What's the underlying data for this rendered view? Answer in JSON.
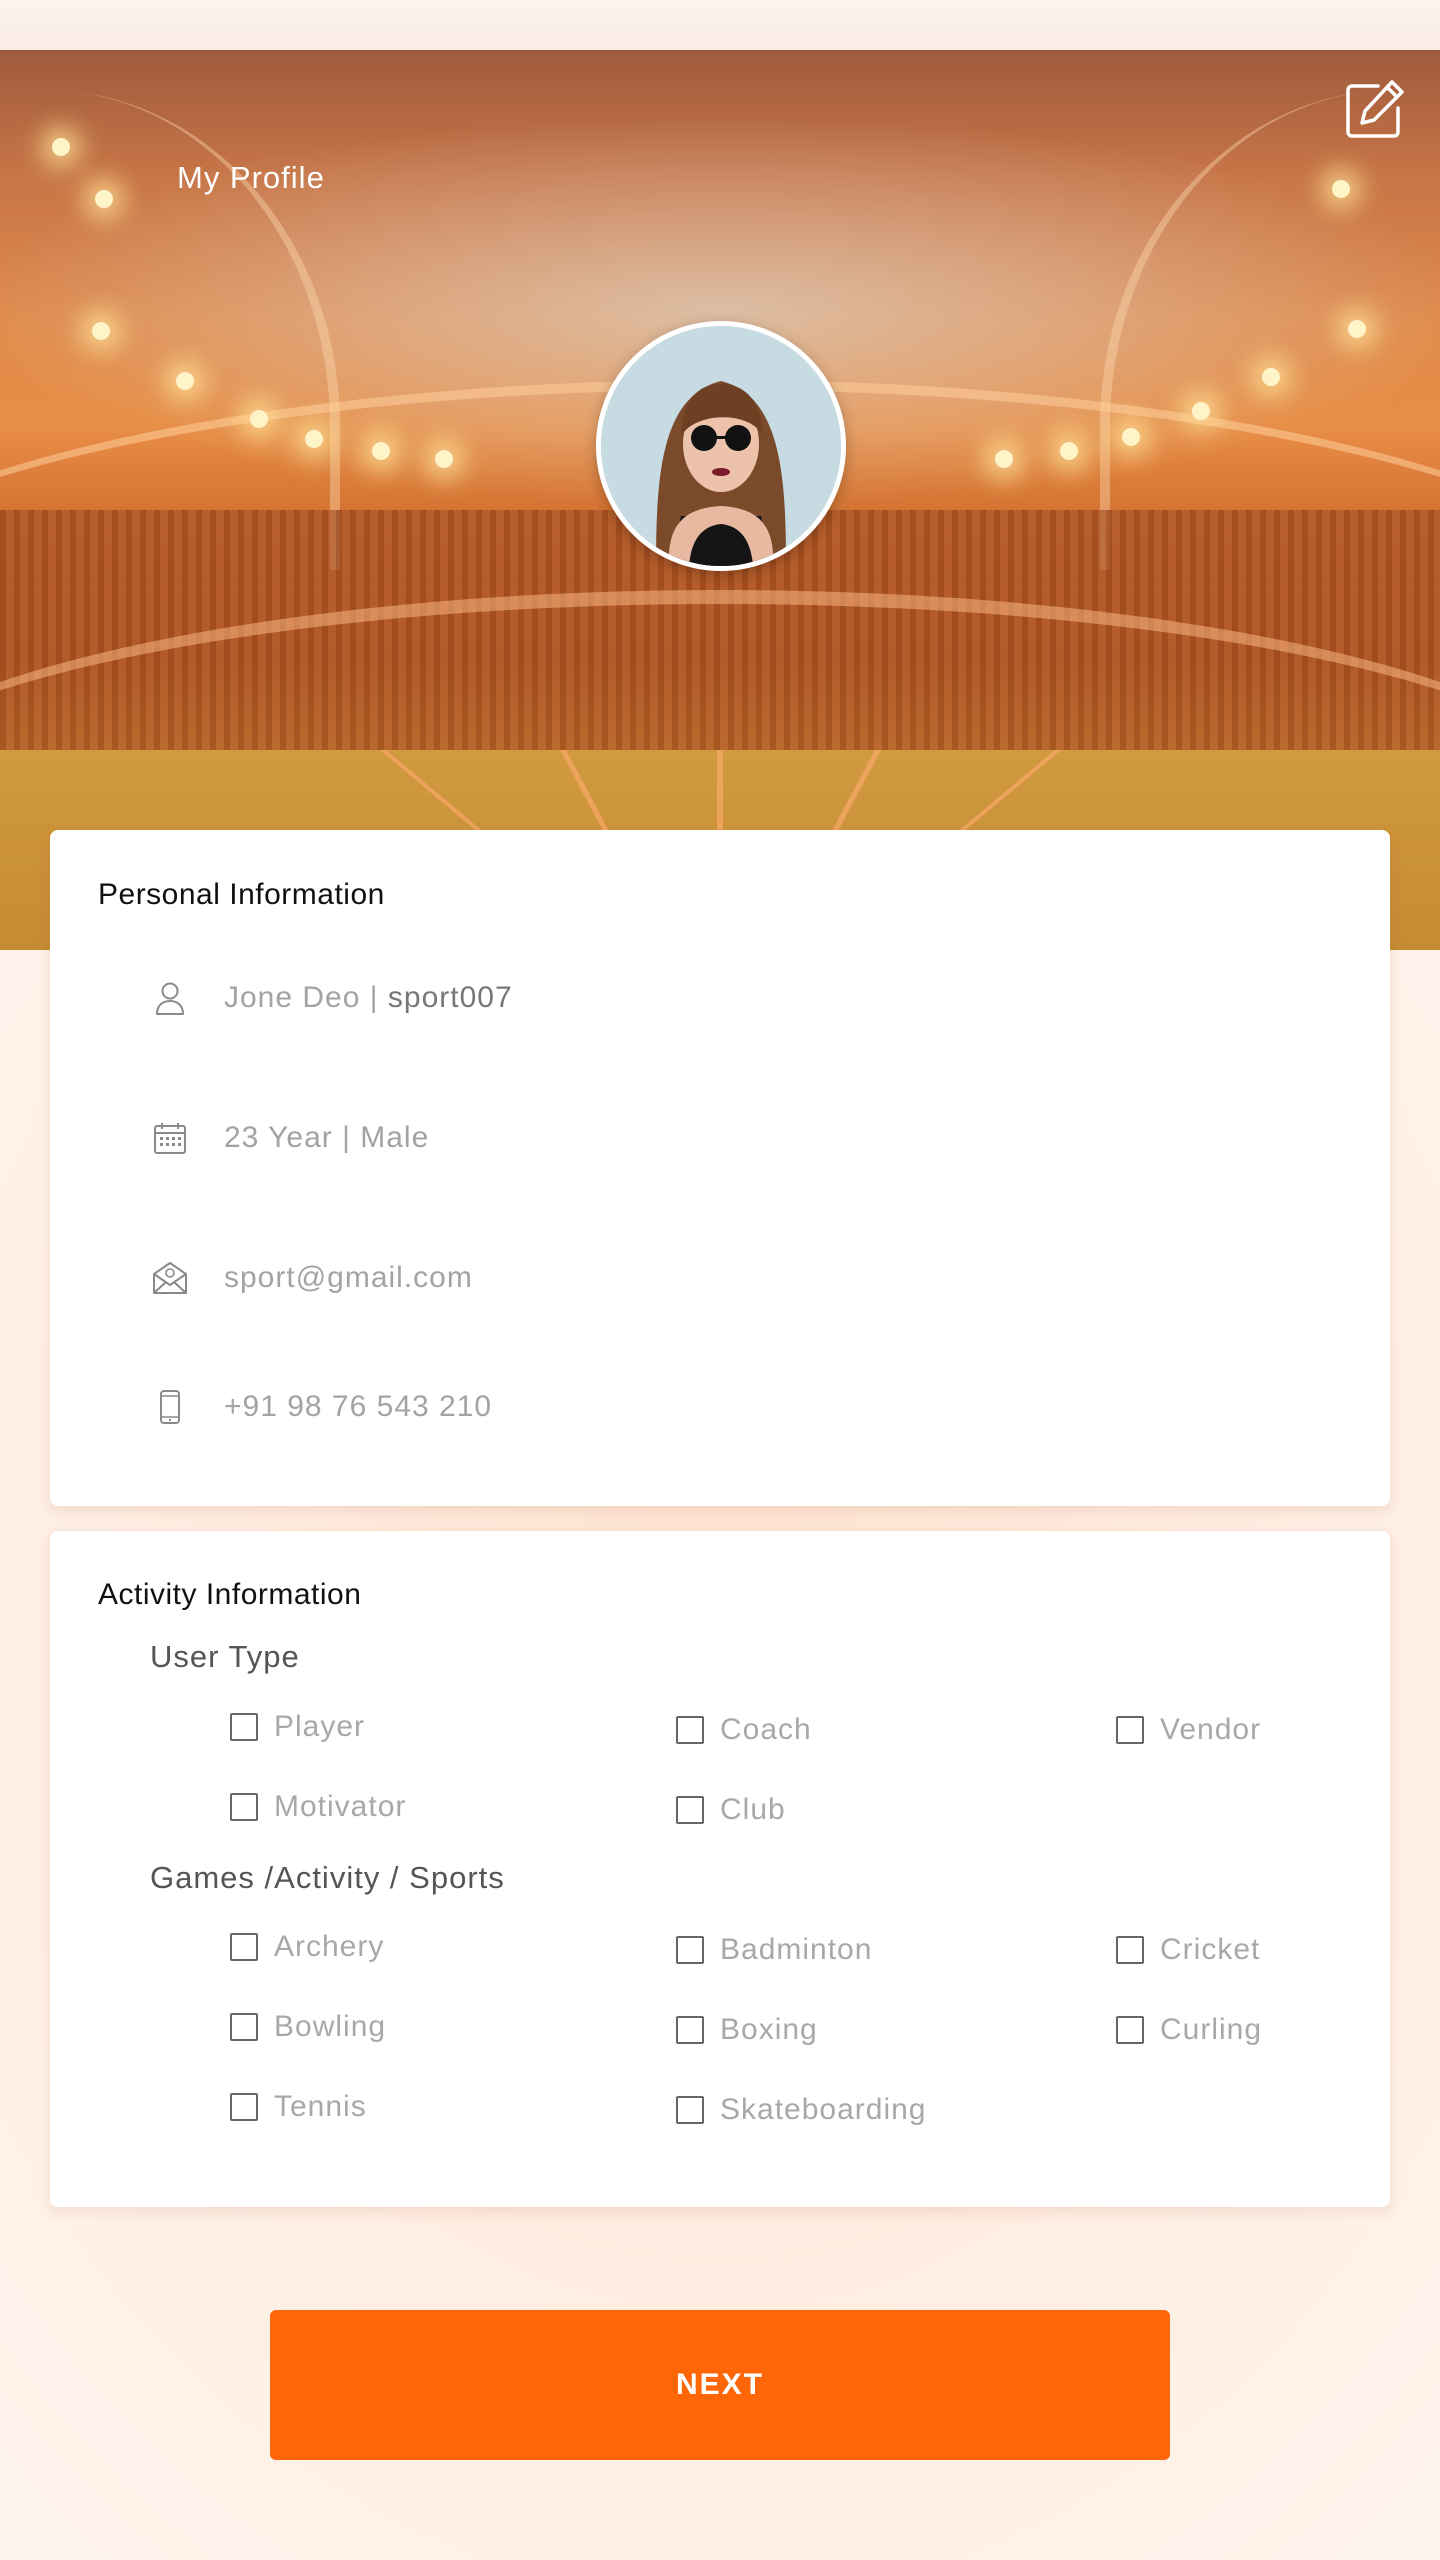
{
  "header": {
    "title": "My Profile",
    "edit_icon": "edit-pencil-icon"
  },
  "profile": {
    "avatar_alt": "profile-photo"
  },
  "personal": {
    "title": "Personal Information",
    "name_prefix": "Jone Deo | ",
    "username": "sport007",
    "age_gender": "23 Year | Male",
    "email": "sport@gmail.com",
    "phone": "+91 98 76 543 210",
    "icons": [
      "user-icon",
      "calendar-icon",
      "email-icon",
      "phone-icon"
    ]
  },
  "activity": {
    "title": "Activity Information",
    "user_type_label": "User Type",
    "user_types": [
      "Player",
      "Coach",
      "Vendor",
      "Motivator",
      "Club"
    ],
    "games_label": "Games /Activity / Sports",
    "games": [
      "Archery",
      "Badminton",
      "Cricket",
      "Bowling",
      "Boxing",
      "Curling",
      "Tennis",
      "Skateboarding"
    ]
  },
  "actions": {
    "next_label": "NEXT"
  },
  "colors": {
    "accent": "#ff6607",
    "hero_tint": "#e08b4c"
  }
}
